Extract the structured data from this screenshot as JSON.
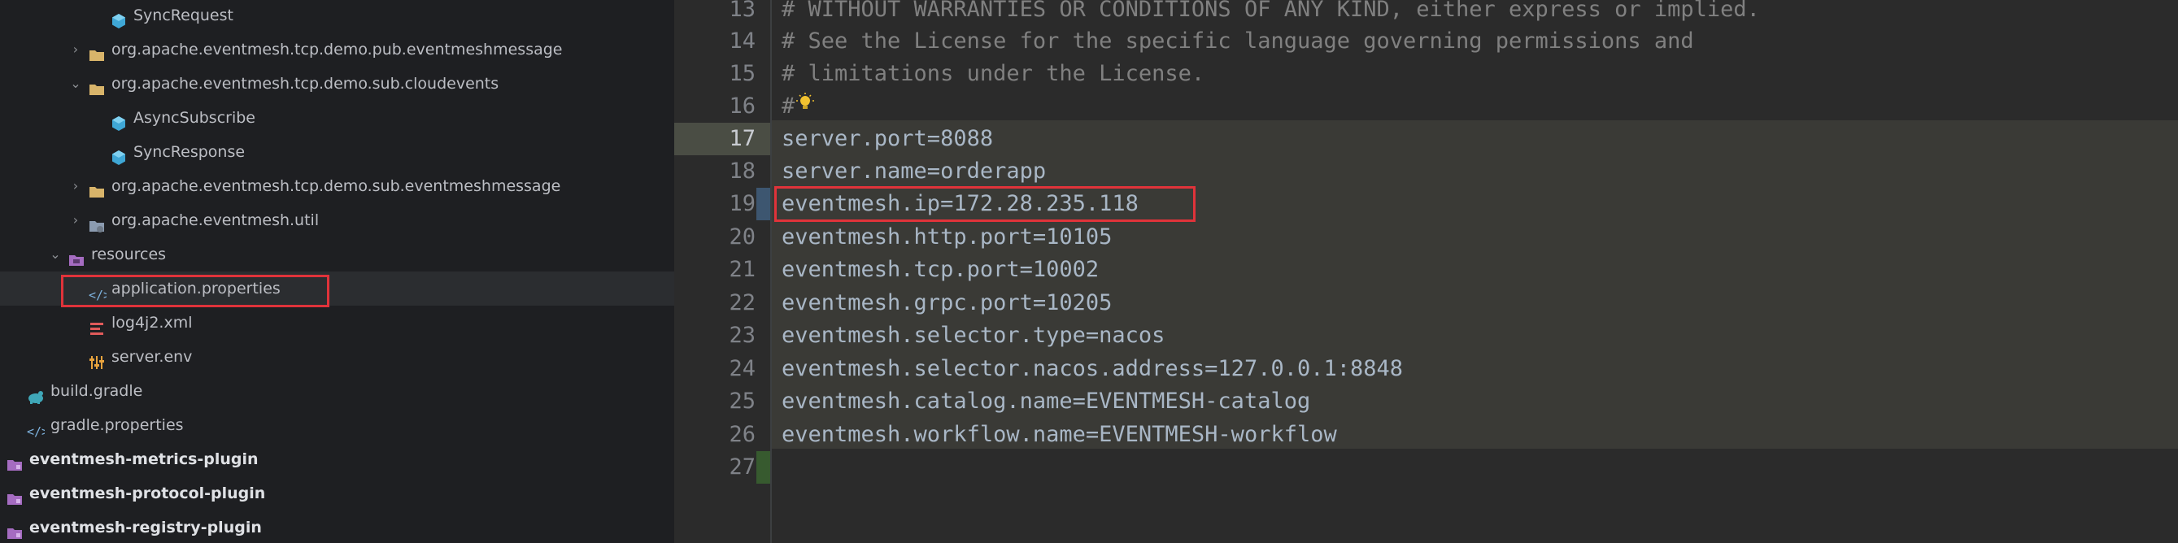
{
  "tree": {
    "items": [
      {
        "label": "SyncRequest",
        "icon": "class-icon"
      },
      {
        "label": "org.apache.eventmesh.tcp.demo.pub.eventmeshmessage",
        "icon": "package-folder-icon"
      },
      {
        "label": "org.apache.eventmesh.tcp.demo.sub.cloudevents",
        "icon": "package-folder-icon"
      },
      {
        "label": "AsyncSubscribe",
        "icon": "class-icon"
      },
      {
        "label": "SyncResponse",
        "icon": "class-icon"
      },
      {
        "label": "org.apache.eventmesh.tcp.demo.sub.eventmeshmessage",
        "icon": "package-folder-icon"
      },
      {
        "label": "org.apache.eventmesh.util",
        "icon": "package-folder-icon"
      },
      {
        "label": "resources",
        "icon": "resources-folder-icon"
      },
      {
        "label": "application.properties",
        "icon": "properties-file-icon"
      },
      {
        "label": "log4j2.xml",
        "icon": "xml-file-icon"
      },
      {
        "label": "server.env",
        "icon": "env-file-icon"
      },
      {
        "label": "build.gradle",
        "icon": "gradle-icon"
      },
      {
        "label": "gradle.properties",
        "icon": "properties-file-icon"
      },
      {
        "label": "eventmesh-metrics-plugin",
        "icon": "module-folder-icon"
      },
      {
        "label": "eventmesh-protocol-plugin",
        "icon": "module-folder-icon"
      },
      {
        "label": "eventmesh-registry-plugin",
        "icon": "module-folder-icon"
      }
    ]
  },
  "editor": {
    "lines": [
      {
        "num": "13",
        "text": "# WITHOUT WARRANTIES OR CONDITIONS OF ANY KIND, either express or implied."
      },
      {
        "num": "14",
        "text": "# See the License for the specific language governing permissions and"
      },
      {
        "num": "15",
        "text": "# limitations under the License."
      },
      {
        "num": "16",
        "text": "#"
      },
      {
        "num": "17",
        "text": "server.port=8088"
      },
      {
        "num": "18",
        "text": "server.name=orderapp"
      },
      {
        "num": "19",
        "text": "eventmesh.ip=172.28.235.118"
      },
      {
        "num": "20",
        "text": "eventmesh.http.port=10105"
      },
      {
        "num": "21",
        "text": "eventmesh.tcp.port=10002"
      },
      {
        "num": "22",
        "text": "eventmesh.grpc.port=10205"
      },
      {
        "num": "23",
        "text": "eventmesh.selector.type=nacos"
      },
      {
        "num": "24",
        "text": "eventmesh.selector.nacos.address=127.0.0.1:8848"
      },
      {
        "num": "25",
        "text": "eventmesh.catalog.name=EVENTMESH-catalog"
      },
      {
        "num": "26",
        "text": "eventmesh.workflow.name=EVENTMESH-workflow"
      },
      {
        "num": "27",
        "text": ""
      }
    ]
  },
  "colors": {
    "highlight_box": "#e0333a",
    "folder": "#d8b46a",
    "class_icon": "#3fa7d6"
  }
}
